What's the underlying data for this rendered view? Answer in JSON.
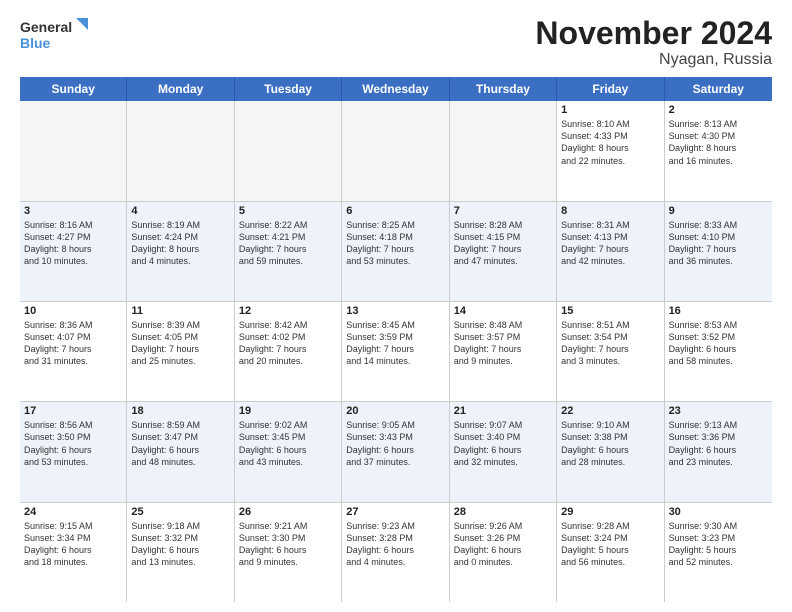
{
  "logo": {
    "line1": "General",
    "line2": "Blue"
  },
  "title": "November 2024",
  "location": "Nyagan, Russia",
  "weekdays": [
    "Sunday",
    "Monday",
    "Tuesday",
    "Wednesday",
    "Thursday",
    "Friday",
    "Saturday"
  ],
  "weeks": [
    [
      {
        "day": "",
        "info": ""
      },
      {
        "day": "",
        "info": ""
      },
      {
        "day": "",
        "info": ""
      },
      {
        "day": "",
        "info": ""
      },
      {
        "day": "",
        "info": ""
      },
      {
        "day": "1",
        "info": "Sunrise: 8:10 AM\nSunset: 4:33 PM\nDaylight: 8 hours\nand 22 minutes."
      },
      {
        "day": "2",
        "info": "Sunrise: 8:13 AM\nSunset: 4:30 PM\nDaylight: 8 hours\nand 16 minutes."
      }
    ],
    [
      {
        "day": "3",
        "info": "Sunrise: 8:16 AM\nSunset: 4:27 PM\nDaylight: 8 hours\nand 10 minutes."
      },
      {
        "day": "4",
        "info": "Sunrise: 8:19 AM\nSunset: 4:24 PM\nDaylight: 8 hours\nand 4 minutes."
      },
      {
        "day": "5",
        "info": "Sunrise: 8:22 AM\nSunset: 4:21 PM\nDaylight: 7 hours\nand 59 minutes."
      },
      {
        "day": "6",
        "info": "Sunrise: 8:25 AM\nSunset: 4:18 PM\nDaylight: 7 hours\nand 53 minutes."
      },
      {
        "day": "7",
        "info": "Sunrise: 8:28 AM\nSunset: 4:15 PM\nDaylight: 7 hours\nand 47 minutes."
      },
      {
        "day": "8",
        "info": "Sunrise: 8:31 AM\nSunset: 4:13 PM\nDaylight: 7 hours\nand 42 minutes."
      },
      {
        "day": "9",
        "info": "Sunrise: 8:33 AM\nSunset: 4:10 PM\nDaylight: 7 hours\nand 36 minutes."
      }
    ],
    [
      {
        "day": "10",
        "info": "Sunrise: 8:36 AM\nSunset: 4:07 PM\nDaylight: 7 hours\nand 31 minutes."
      },
      {
        "day": "11",
        "info": "Sunrise: 8:39 AM\nSunset: 4:05 PM\nDaylight: 7 hours\nand 25 minutes."
      },
      {
        "day": "12",
        "info": "Sunrise: 8:42 AM\nSunset: 4:02 PM\nDaylight: 7 hours\nand 20 minutes."
      },
      {
        "day": "13",
        "info": "Sunrise: 8:45 AM\nSunset: 3:59 PM\nDaylight: 7 hours\nand 14 minutes."
      },
      {
        "day": "14",
        "info": "Sunrise: 8:48 AM\nSunset: 3:57 PM\nDaylight: 7 hours\nand 9 minutes."
      },
      {
        "day": "15",
        "info": "Sunrise: 8:51 AM\nSunset: 3:54 PM\nDaylight: 7 hours\nand 3 minutes."
      },
      {
        "day": "16",
        "info": "Sunrise: 8:53 AM\nSunset: 3:52 PM\nDaylight: 6 hours\nand 58 minutes."
      }
    ],
    [
      {
        "day": "17",
        "info": "Sunrise: 8:56 AM\nSunset: 3:50 PM\nDaylight: 6 hours\nand 53 minutes."
      },
      {
        "day": "18",
        "info": "Sunrise: 8:59 AM\nSunset: 3:47 PM\nDaylight: 6 hours\nand 48 minutes."
      },
      {
        "day": "19",
        "info": "Sunrise: 9:02 AM\nSunset: 3:45 PM\nDaylight: 6 hours\nand 43 minutes."
      },
      {
        "day": "20",
        "info": "Sunrise: 9:05 AM\nSunset: 3:43 PM\nDaylight: 6 hours\nand 37 minutes."
      },
      {
        "day": "21",
        "info": "Sunrise: 9:07 AM\nSunset: 3:40 PM\nDaylight: 6 hours\nand 32 minutes."
      },
      {
        "day": "22",
        "info": "Sunrise: 9:10 AM\nSunset: 3:38 PM\nDaylight: 6 hours\nand 28 minutes."
      },
      {
        "day": "23",
        "info": "Sunrise: 9:13 AM\nSunset: 3:36 PM\nDaylight: 6 hours\nand 23 minutes."
      }
    ],
    [
      {
        "day": "24",
        "info": "Sunrise: 9:15 AM\nSunset: 3:34 PM\nDaylight: 6 hours\nand 18 minutes."
      },
      {
        "day": "25",
        "info": "Sunrise: 9:18 AM\nSunset: 3:32 PM\nDaylight: 6 hours\nand 13 minutes."
      },
      {
        "day": "26",
        "info": "Sunrise: 9:21 AM\nSunset: 3:30 PM\nDaylight: 6 hours\nand 9 minutes."
      },
      {
        "day": "27",
        "info": "Sunrise: 9:23 AM\nSunset: 3:28 PM\nDaylight: 6 hours\nand 4 minutes."
      },
      {
        "day": "28",
        "info": "Sunrise: 9:26 AM\nSunset: 3:26 PM\nDaylight: 6 hours\nand 0 minutes."
      },
      {
        "day": "29",
        "info": "Sunrise: 9:28 AM\nSunset: 3:24 PM\nDaylight: 5 hours\nand 56 minutes."
      },
      {
        "day": "30",
        "info": "Sunrise: 9:30 AM\nSunset: 3:23 PM\nDaylight: 5 hours\nand 52 minutes."
      }
    ]
  ]
}
